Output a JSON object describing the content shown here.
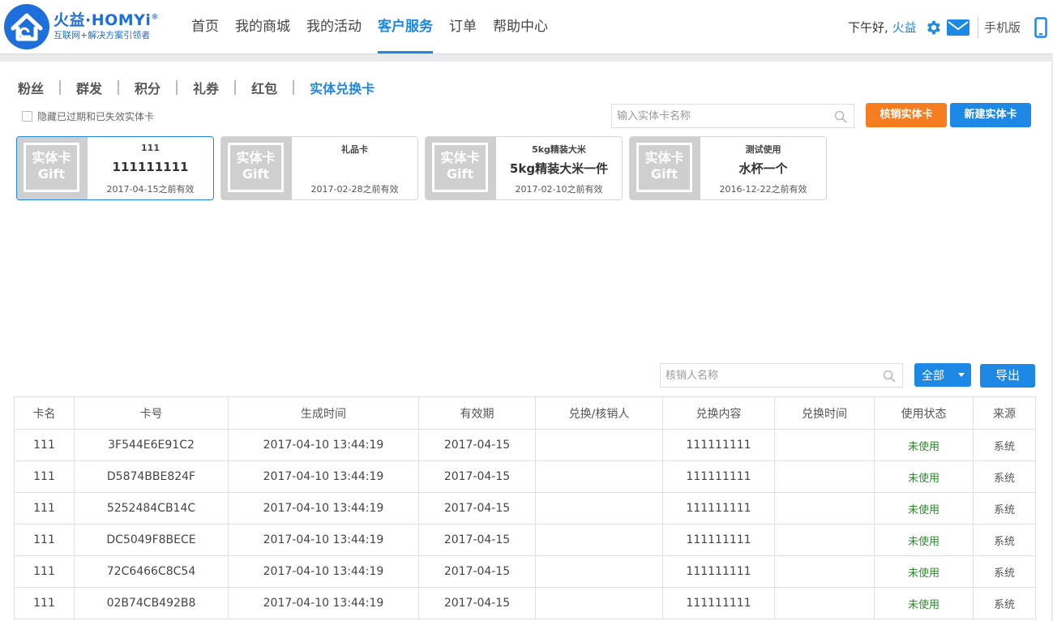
{
  "brand": {
    "name": "火益·HOMYi",
    "registered": "®",
    "slogan": "互联网+解决方案引领者"
  },
  "nav": {
    "items": [
      {
        "label": "首页"
      },
      {
        "label": "我的商城"
      },
      {
        "label": "我的活动"
      },
      {
        "label": "客户服务",
        "active": true
      },
      {
        "label": "订单"
      },
      {
        "label": "帮助中心"
      }
    ]
  },
  "user": {
    "greeting": "下午好,",
    "name": "火益",
    "mobile_label": "手机版"
  },
  "tabs": [
    {
      "label": "粉丝"
    },
    {
      "label": "群发"
    },
    {
      "label": "积分"
    },
    {
      "label": "礼券"
    },
    {
      "label": "红包"
    },
    {
      "label": "实体兑换卡",
      "active": true
    }
  ],
  "filters": {
    "hide_expired_label": "隐藏已过期和已失效实体卡",
    "card_search_placeholder": "输入实体卡名称",
    "verify_button": "核销实体卡",
    "create_button": "新建实体卡",
    "verifier_search_placeholder": "核销人名称",
    "status_select": "全部",
    "export_button": "导出"
  },
  "cards": [
    {
      "thumb_line1": "实体卡",
      "thumb_line2": "Gift",
      "name": "111",
      "content": "111111111",
      "valid": "2017-04-15之前有效",
      "selected": true
    },
    {
      "thumb_line1": "实体卡",
      "thumb_line2": "Gift",
      "name": "礼品卡",
      "content": "",
      "valid": "2017-02-28之前有效"
    },
    {
      "thumb_line1": "实体卡",
      "thumb_line2": "Gift",
      "name": "5kg精装大米",
      "content": "5kg精装大米一件",
      "valid": "2017-02-10之前有效"
    },
    {
      "thumb_line1": "实体卡",
      "thumb_line2": "Gift",
      "name": "测试使用",
      "content": "水杯一个",
      "valid": "2016-12-22之前有效"
    }
  ],
  "table": {
    "columns": [
      "卡名",
      "卡号",
      "生成时间",
      "有效期",
      "兑换/核销人",
      "兑换内容",
      "兑换时间",
      "使用状态",
      "来源"
    ],
    "rows": [
      [
        "111",
        "3F544E6E91C2",
        "2017-04-10 13:44:19",
        "2017-04-15",
        "",
        "111111111",
        "",
        "未使用",
        "系统"
      ],
      [
        "111",
        "D5874BBE824F",
        "2017-04-10 13:44:19",
        "2017-04-15",
        "",
        "111111111",
        "",
        "未使用",
        "系统"
      ],
      [
        "111",
        "5252484CB14C",
        "2017-04-10 13:44:19",
        "2017-04-15",
        "",
        "111111111",
        "",
        "未使用",
        "系统"
      ],
      [
        "111",
        "DC5049F8BECE",
        "2017-04-10 13:44:19",
        "2017-04-15",
        "",
        "111111111",
        "",
        "未使用",
        "系统"
      ],
      [
        "111",
        "72C6466C8C54",
        "2017-04-10 13:44:19",
        "2017-04-15",
        "",
        "111111111",
        "",
        "未使用",
        "系统"
      ],
      [
        "111",
        "02B74CB492B8",
        "2017-04-10 13:44:19",
        "2017-04-15",
        "",
        "111111111",
        "",
        "未使用",
        "系统"
      ]
    ]
  },
  "colors": {
    "accent": "#1e88e5",
    "orange": "#f57c1f",
    "status_unused": "#2e8b2e"
  }
}
